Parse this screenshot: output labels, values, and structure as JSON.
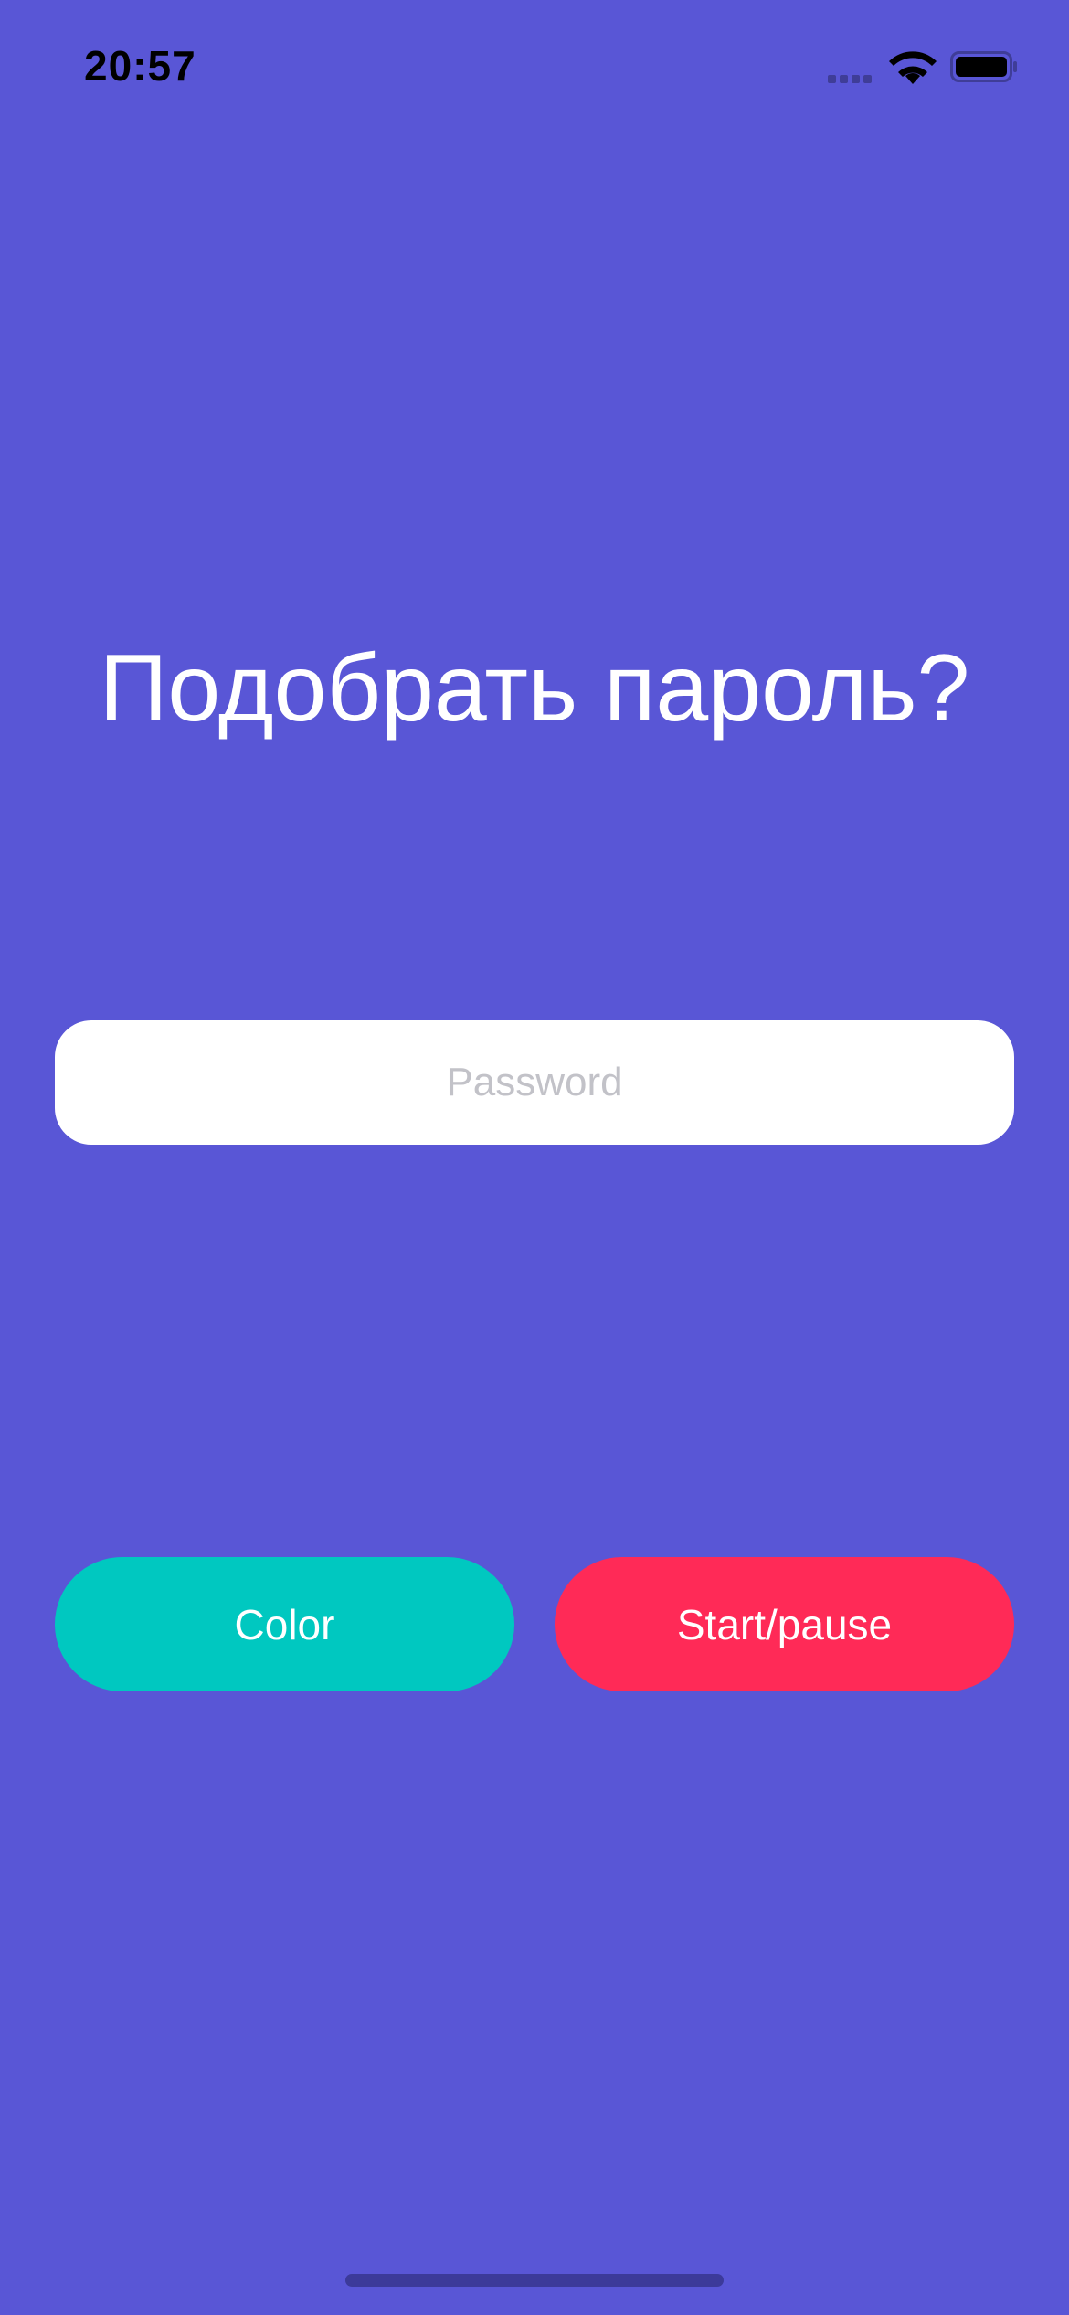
{
  "status_bar": {
    "time": "20:57"
  },
  "main": {
    "title": "Подобрать пароль?",
    "password_field": {
      "value": "",
      "placeholder": "Password"
    },
    "buttons": {
      "color_label": "Color",
      "start_pause_label": "Start/pause"
    }
  },
  "colors": {
    "background": "#5956d6",
    "color_button": "#00c8c0",
    "start_button": "#ff2a57",
    "title_text": "#ffffff",
    "placeholder": "#c2c2c8"
  },
  "icons": {
    "signal": "cellular-signal-icon",
    "wifi": "wifi-icon",
    "battery": "battery-icon"
  }
}
